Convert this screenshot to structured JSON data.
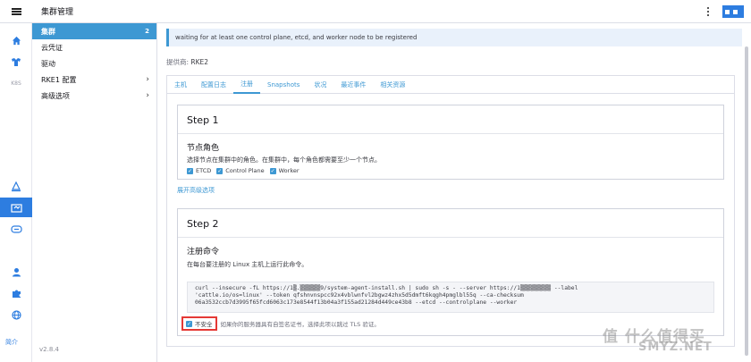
{
  "header": {
    "title": "集群管理"
  },
  "rail": {
    "k8s_label": "K8S",
    "bottom_link": "简介"
  },
  "sidenav": {
    "items": [
      {
        "label": "集群",
        "badge": "2"
      },
      {
        "label": "云凭证"
      },
      {
        "label": "驱动"
      },
      {
        "label": "RKE1 配置",
        "chevron": "›"
      },
      {
        "label": "高级选项",
        "chevron": "›"
      }
    ],
    "version": "v2.8.4"
  },
  "banner": {
    "text": "waiting for at least one control plane, etcd, and worker node to be registered"
  },
  "provider": {
    "label": "提供商:",
    "value": "RKE2"
  },
  "tabs": [
    "主机",
    "配置日志",
    "注册",
    "Snapshots",
    "状况",
    "最近事件",
    "相关资源"
  ],
  "step1": {
    "title": "Step 1",
    "subtitle": "节点角色",
    "desc": "选择节点在集群中的角色。在集群中，每个角色都需要至少一个节点。",
    "roles": [
      "ETCD",
      "Control Plane",
      "Worker"
    ]
  },
  "advanced_link": "展开高级选项",
  "step2": {
    "title": "Step 2",
    "subtitle": "注册命令",
    "desc": "在每台要注册的 Linux 主机上运行此命令。",
    "command_line1": "curl --insecure -fL https://1▒.▒▒▒▒▒▒9/system-agent-install.sh | sudo sh -s - --server https://1▒▒▒▒▒▒▒▒▒ --label",
    "command_line2": "'cattle.io/os=linux' --token qfshnvnspcc92x4vblwnfvl2bgwz4zhx5d5dmft6kqgh4pmglbl55q --ca-checksum",
    "command_line3": "06a3532ccb7d3995f65fcd6063c173e8544f13b04a3f155ad21284d449ce43b8 --etcd --controlplane --worker",
    "insecure_label": "不安全",
    "insecure_note": "如果你的服务器具有自签名证书，选择此项以跳过 TLS 验证。"
  },
  "watermark": {
    "main": "值 什么值得买",
    "sub": "SMYZ.NET"
  },
  "colors": {
    "accent": "#3d98d3",
    "highlight": "#e53935"
  }
}
